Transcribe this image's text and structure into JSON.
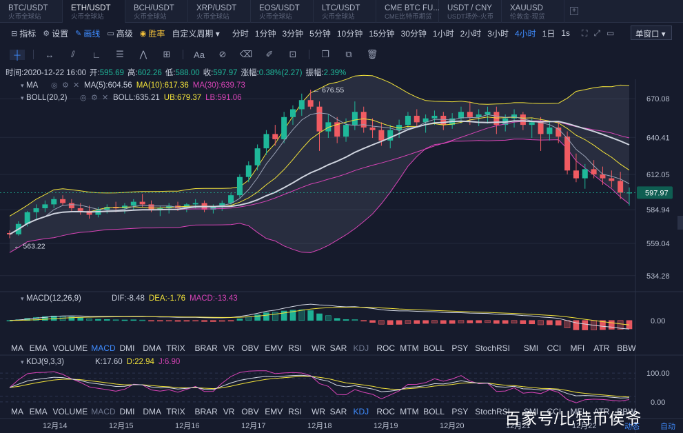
{
  "tabs": [
    {
      "symbol": "BTC/USDT",
      "source": "火币全球站",
      "active": false
    },
    {
      "symbol": "ETH/USDT",
      "source": "火币全球站",
      "active": true
    },
    {
      "symbol": "BCH/USDT",
      "source": "火币全球站",
      "active": false
    },
    {
      "symbol": "XRP/USDT",
      "source": "火币全球站",
      "active": false
    },
    {
      "symbol": "EOS/USDT",
      "source": "火币全球站",
      "active": false
    },
    {
      "symbol": "LTC/USDT",
      "source": "火币全球站",
      "active": false
    },
    {
      "symbol": "CME BTC FU...",
      "source": "CME比特币期货",
      "active": false
    },
    {
      "symbol": "USDT / CNY",
      "source": "USDT场外-火币",
      "active": false
    },
    {
      "symbol": "XAUUSD",
      "source": "伦敦金-现货",
      "active": false
    }
  ],
  "tab_add": "+",
  "toolbar": {
    "items": [
      {
        "label": "指标",
        "icon": "indicator-icon",
        "glyph": "⊟",
        "style": "normal"
      },
      {
        "label": "设置",
        "icon": "gear-icon",
        "glyph": "⚙",
        "style": "normal"
      },
      {
        "label": "画线",
        "icon": "pencil-icon",
        "glyph": "✎",
        "style": "hl"
      },
      {
        "label": "高级",
        "icon": "advanced-icon",
        "glyph": "▭",
        "style": "normal"
      },
      {
        "label": "胜率",
        "icon": "winrate-icon",
        "glyph": "◉",
        "style": "warn"
      }
    ],
    "custom_period": "自定义周期 ▾",
    "periods": [
      "分时",
      "1分钟",
      "3分钟",
      "5分钟",
      "10分钟",
      "15分钟",
      "30分钟",
      "1小时",
      "2小时",
      "3小时",
      "4小时",
      "1日"
    ],
    "active_period": "4小时",
    "second": "1s",
    "window_select": "单窗口 ▾"
  },
  "drawing_tools": [
    {
      "name": "crosshair-tool-icon",
      "glyph": "┼",
      "active": true
    },
    {
      "name": "horizontal-line-tool-icon",
      "glyph": "↔",
      "active": false
    },
    {
      "name": "channel-tool-icon",
      "glyph": "⫽",
      "active": false
    },
    {
      "name": "angle-tool-icon",
      "glyph": "∟",
      "active": false
    },
    {
      "name": "fib-tool-icon",
      "glyph": "☰",
      "active": false
    },
    {
      "name": "wave-tool-icon",
      "glyph": "⋀",
      "active": false
    },
    {
      "name": "shape-tool-icon",
      "glyph": "⊞",
      "active": false
    },
    {
      "name": "text-tool-icon",
      "glyph": "Aa",
      "active": false
    },
    {
      "name": "magnet-tool-icon",
      "glyph": "⊘",
      "active": false
    },
    {
      "name": "eraser-tool-icon",
      "glyph": "⌫",
      "active": false
    },
    {
      "name": "pen-tool-icon",
      "glyph": "✐",
      "active": false
    },
    {
      "name": "lock-tool-icon",
      "glyph": "⊡",
      "active": false
    },
    {
      "name": "copy-tool-icon",
      "glyph": "❐",
      "active": false
    },
    {
      "name": "duplicate-tool-icon",
      "glyph": "⧉",
      "active": false
    },
    {
      "name": "trash-tool-icon",
      "glyph": "🗑",
      "active": false
    }
  ],
  "info_bar": [
    {
      "text": "时间:2020-12-22 16:00",
      "color": "#c9cfdd"
    },
    {
      "text": "开:",
      "color": "#c9cfdd"
    },
    {
      "text": "595.69",
      "color": "#1fb89a"
    },
    {
      "text": "高:",
      "color": "#c9cfdd"
    },
    {
      "text": "602.26",
      "color": "#1fb89a"
    },
    {
      "text": "低:",
      "color": "#c9cfdd"
    },
    {
      "text": "588.00",
      "color": "#1fb89a"
    },
    {
      "text": "收:",
      "color": "#c9cfdd"
    },
    {
      "text": "597.97",
      "color": "#1fb89a"
    },
    {
      "text": "涨幅:",
      "color": "#c9cfdd"
    },
    {
      "text": "0.38%(2.27)",
      "color": "#1fb89a"
    },
    {
      "text": "振幅:",
      "color": "#c9cfdd"
    },
    {
      "text": "2.39%",
      "color": "#1fb89a"
    }
  ],
  "legends": {
    "ma": {
      "name": "MA",
      "items": [
        {
          "text": "MA(5):604.56",
          "color": "#c9cfdd"
        },
        {
          "text": "MA(10):617.36",
          "color": "#f3e33a"
        },
        {
          "text": "MA(30):639.73",
          "color": "#d944b8"
        }
      ]
    },
    "boll": {
      "name": "BOLL(20,2)",
      "items": [
        {
          "text": "BOLL:635.21",
          "color": "#c9cfdd"
        },
        {
          "text": "UB:679.37",
          "color": "#f3e33a"
        },
        {
          "text": "LB:591.06",
          "color": "#d944b8"
        }
      ]
    },
    "macd": {
      "name": "MACD(12,26,9)",
      "items": [
        {
          "text": "DIF:-8.48",
          "color": "#c9cfdd"
        },
        {
          "text": "DEA:-1.76",
          "color": "#f3e33a"
        },
        {
          "text": "MACD:-13.43",
          "color": "#d944b8"
        }
      ]
    },
    "kdj": {
      "name": "KDJ(9,3,3)",
      "items": [
        {
          "text": "K:17.60",
          "color": "#c9cfdd"
        },
        {
          "text": "D:22.94",
          "color": "#f3e33a"
        },
        {
          "text": "J:6.90",
          "color": "#d944b8"
        }
      ]
    }
  },
  "indicator_tabs": [
    "MA",
    "EMA",
    "VOLUME",
    "MACD",
    "DMI",
    "DMA",
    "TRIX",
    "BRAR",
    "VR",
    "OBV",
    "EMV",
    "RSI",
    "WR",
    "SAR",
    "KDJ",
    "ROC",
    "MTM",
    "BOLL",
    "PSY",
    "StochRSI",
    "SMI",
    "CCI",
    "MFI",
    "ATR",
    "BBW"
  ],
  "active_indicator_main": "MACD",
  "active_indicator_sub": "KDJ",
  "colors": {
    "up": "#1fb89a",
    "down": "#f05b62",
    "ma5": "#9aa2b6",
    "ma10": "#f3e33a",
    "ma30": "#d944b8",
    "boll": "#cfd4df",
    "accent": "#3f8cff"
  },
  "chart_data": {
    "type": "candlestick",
    "price_axis": {
      "ticks": [
        670.08,
        640.41,
        612.05,
        584.94,
        559.04,
        534.28
      ],
      "ylim": [
        522,
        685
      ],
      "last_price": "597.97"
    },
    "annotations": {
      "high": "← 676.55",
      "low": "← 563.22"
    },
    "x_ticks": [
      "12月14",
      "12月15",
      "12月16",
      "12月17",
      "12月18",
      "12月19",
      "12月20",
      "12月21",
      "12月22"
    ],
    "candles": [
      [
        567,
        569,
        563,
        566
      ],
      [
        566,
        576,
        565,
        574
      ],
      [
        574,
        584,
        572,
        583
      ],
      [
        583,
        589,
        578,
        586
      ],
      [
        586,
        592,
        583,
        589
      ],
      [
        589,
        595,
        586,
        593
      ],
      [
        593,
        596,
        588,
        590
      ],
      [
        590,
        593,
        584,
        586
      ],
      [
        586,
        590,
        581,
        584
      ],
      [
        584,
        588,
        578,
        581
      ],
      [
        581,
        587,
        579,
        585
      ],
      [
        585,
        589,
        582,
        587
      ],
      [
        587,
        591,
        583,
        586
      ],
      [
        586,
        590,
        582,
        588
      ],
      [
        588,
        593,
        585,
        591
      ],
      [
        591,
        597,
        587,
        589
      ],
      [
        589,
        592,
        583,
        585
      ],
      [
        585,
        588,
        580,
        586
      ],
      [
        586,
        590,
        582,
        588
      ],
      [
        588,
        591,
        584,
        586
      ],
      [
        586,
        590,
        583,
        589
      ],
      [
        589,
        593,
        586,
        590
      ],
      [
        590,
        592,
        583,
        585
      ],
      [
        585,
        589,
        582,
        587
      ],
      [
        587,
        592,
        584,
        590
      ],
      [
        590,
        598,
        588,
        596
      ],
      [
        596,
        612,
        594,
        610
      ],
      [
        610,
        622,
        606,
        619
      ],
      [
        619,
        635,
        615,
        632
      ],
      [
        632,
        646,
        627,
        643
      ],
      [
        643,
        650,
        634,
        639
      ],
      [
        639,
        660,
        636,
        656
      ],
      [
        656,
        665,
        650,
        662
      ],
      [
        662,
        674,
        657,
        669
      ],
      [
        669,
        677,
        662,
        664
      ],
      [
        664,
        668,
        630,
        645
      ],
      [
        645,
        658,
        640,
        652
      ],
      [
        652,
        656,
        636,
        641
      ],
      [
        641,
        655,
        637,
        650
      ],
      [
        650,
        668,
        646,
        660
      ],
      [
        660,
        664,
        644,
        648
      ],
      [
        648,
        655,
        640,
        646
      ],
      [
        646,
        652,
        634,
        638
      ],
      [
        638,
        650,
        632,
        646
      ],
      [
        646,
        654,
        640,
        650
      ],
      [
        650,
        660,
        647,
        657
      ],
      [
        657,
        662,
        648,
        652
      ],
      [
        652,
        658,
        644,
        655
      ],
      [
        655,
        661,
        650,
        657
      ],
      [
        657,
        660,
        646,
        650
      ],
      [
        650,
        659,
        647,
        655
      ],
      [
        655,
        664,
        651,
        660
      ],
      [
        660,
        668,
        650,
        656
      ],
      [
        656,
        662,
        649,
        658
      ],
      [
        658,
        664,
        651,
        660
      ],
      [
        660,
        664,
        643,
        650
      ],
      [
        650,
        658,
        645,
        655
      ],
      [
        655,
        662,
        648,
        658
      ],
      [
        658,
        660,
        646,
        650
      ],
      [
        650,
        655,
        640,
        652
      ],
      [
        652,
        656,
        630,
        643
      ],
      [
        643,
        652,
        638,
        648
      ],
      [
        648,
        652,
        636,
        641
      ],
      [
        641,
        645,
        612,
        615
      ],
      [
        615,
        628,
        606,
        609
      ],
      [
        609,
        620,
        601,
        616
      ],
      [
        616,
        623,
        609,
        612
      ],
      [
        612,
        618,
        604,
        609
      ],
      [
        609,
        615,
        602,
        607
      ],
      [
        607,
        614,
        593,
        598
      ],
      [
        598,
        602,
        588,
        598
      ]
    ],
    "macd": {
      "ylim": [
        -20,
        25
      ],
      "tick": "0.00"
    },
    "kdj": {
      "ylim": [
        -5,
        110
      ],
      "ticks": [
        "100.00",
        "0.00"
      ]
    }
  },
  "watermark": "百家号/比特币侯爷",
  "watermark_corner": "动态",
  "watermark_corner_2": "自动"
}
